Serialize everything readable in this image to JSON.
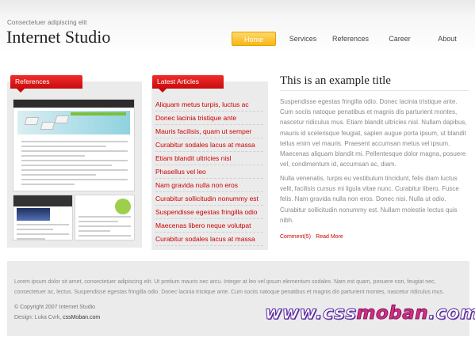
{
  "header": {
    "tagline": "Consectetuer adipiscing elit",
    "logo": "Internet Studio"
  },
  "nav": {
    "items": [
      {
        "label": "Home",
        "active": true
      },
      {
        "label": "Services",
        "active": false
      },
      {
        "label": "References",
        "active": false
      },
      {
        "label": "Career",
        "active": false
      },
      {
        "label": "About",
        "active": false
      }
    ]
  },
  "references": {
    "tab_label": "References"
  },
  "articles": {
    "tab_label": "Latest Articles",
    "items": [
      "Aliquam metus turpis, luctus ac",
      "Donec lacinia tristique ante",
      "Mauris facilisis, quam ut semper",
      "Curabitur sodales lacus at massa",
      "Etiam blandit ultricies nisl",
      "Phasellus vel leo",
      "Nam gravida nulla non eros",
      "Curabitur sollicitudin nonummy est",
      "Suspendisse egestas fringilla odio",
      "Maecenas libero neque volutpat",
      "Curabitur sodales lacus at massa"
    ]
  },
  "main": {
    "title": "This is an example title",
    "paragraph1": "Suspendisse egestas fringilla odio. Donec lacinia tristique ante. Cum sociis natoque penatibus et magnis dis parturient montes, nascetur ridiculus mus. Etiam blandit ultricies nisl. Nullam dapibus, mauris id scelerisque feugiat, sapien augue porta ipsum, ut blandit tellus enim vel mauris. Praesent accumsan metus vel ipsum. Maecenas aliquam blandit mi. Pellentesque dolor magna, posuere vel, condimentum id, accumsan ac, diam.",
    "paragraph2": "Nulla venenatis, turpis eu vestibulum tincidunt, felis diam luctus velit, facilisis cursus mi ligula vitae nunc. Curabitur libero. Fusce felis. Nam gravida nulla non eros. Donec nisi. Nulla ut odio. Curabitur sollicitudin nonummy est. Nullam molestie lectus quis nibh.",
    "comments_link": "Comment(5)",
    "separator": "·",
    "readmore_link": "Read More"
  },
  "footer": {
    "text": "Lorem ipsum dolor sit amet, consectetuer adipiscing elit. Ut pretium mauris nec arcu. Integer at leo vel ipsum elementum sodales. Nam est quam, posuere non, feugiat nec, consectetuer ac, lectus. Suspendisse egestas fringilla odio. Donec lacinia tristique ante. Cum sociis natoque penatibus et magnis dis parturient montes, nascetur ridiculus mus.",
    "copyright": "© Copyright 2007 Internet Studio",
    "design_prefix": "Design: Luka Cvrk, ",
    "design_link": "cssMoban.com"
  },
  "watermark": {
    "part1": "www.css",
    "part2": "moban",
    "part3": ".com"
  },
  "colors": {
    "accent_red": "#cc0000",
    "nav_active": "#f7b716",
    "panel_bg": "#ebebeb"
  }
}
